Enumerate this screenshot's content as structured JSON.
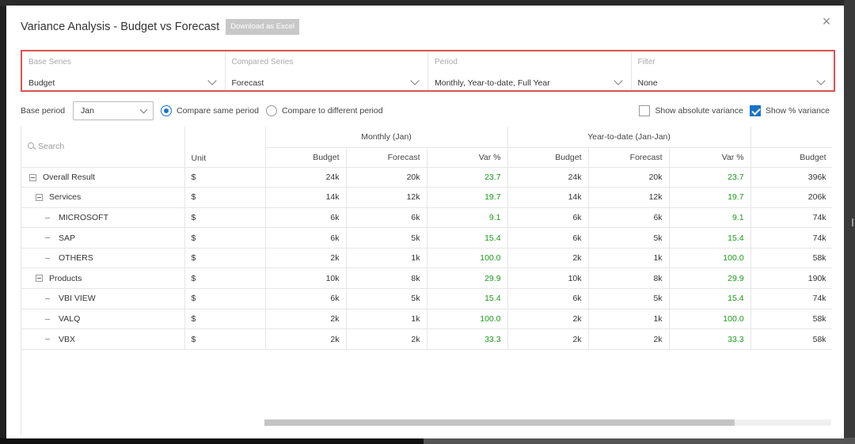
{
  "dialog": {
    "title": "Variance Analysis - Budget vs Forecast",
    "download_label": "Download as Excel",
    "close_glyph": "×"
  },
  "series": [
    {
      "label": "Base Series",
      "value": "Budget"
    },
    {
      "label": "Compared Series",
      "value": "Forecast"
    },
    {
      "label": "Period",
      "value": "Monthly, Year-to-date, Full Year"
    },
    {
      "label": "Filter",
      "value": "None"
    }
  ],
  "options": {
    "base_period_label": "Base period",
    "base_period_value": "Jan",
    "compare_same": "Compare same period",
    "compare_different": "Compare to different period",
    "compare_same_selected": true,
    "show_absolute": "Show absolute variance",
    "show_absolute_checked": false,
    "show_pct": "Show % variance",
    "show_pct_checked": true
  },
  "table": {
    "search_placeholder": "Search",
    "unit_header": "Unit",
    "groups": [
      "Monthly (Jan)",
      "Year-to-date (Jan-Jan)"
    ],
    "sub_headers": [
      "Budget",
      "Forecast",
      "Var %",
      "Budget",
      "Forecast",
      "Var %",
      "Budget"
    ],
    "rows": [
      {
        "name": "Overall Result",
        "level": 0,
        "type": "group",
        "unit": "$",
        "m_budget": "24k",
        "m_forecast": "20k",
        "m_var": "23.7",
        "y_budget": "24k",
        "y_forecast": "20k",
        "y_var": "23.7",
        "fy_budget": "396k"
      },
      {
        "name": "Services",
        "level": 1,
        "type": "group",
        "unit": "$",
        "m_budget": "14k",
        "m_forecast": "12k",
        "m_var": "19.7",
        "y_budget": "14k",
        "y_forecast": "12k",
        "y_var": "19.7",
        "fy_budget": "206k"
      },
      {
        "name": "MICROSOFT",
        "level": 2,
        "type": "leaf",
        "unit": "$",
        "m_budget": "6k",
        "m_forecast": "6k",
        "m_var": "9.1",
        "y_budget": "6k",
        "y_forecast": "6k",
        "y_var": "9.1",
        "fy_budget": "74k"
      },
      {
        "name": "SAP",
        "level": 2,
        "type": "leaf",
        "unit": "$",
        "m_budget": "6k",
        "m_forecast": "5k",
        "m_var": "15.4",
        "y_budget": "6k",
        "y_forecast": "5k",
        "y_var": "15.4",
        "fy_budget": "74k"
      },
      {
        "name": "OTHERS",
        "level": 2,
        "type": "leaf",
        "unit": "$",
        "m_budget": "2k",
        "m_forecast": "1k",
        "m_var": "100.0",
        "y_budget": "2k",
        "y_forecast": "1k",
        "y_var": "100.0",
        "fy_budget": "58k"
      },
      {
        "name": "Products",
        "level": 1,
        "type": "group",
        "unit": "$",
        "m_budget": "10k",
        "m_forecast": "8k",
        "m_var": "29.9",
        "y_budget": "10k",
        "y_forecast": "8k",
        "y_var": "29.9",
        "fy_budget": "190k"
      },
      {
        "name": "VBI VIEW",
        "level": 2,
        "type": "leaf",
        "unit": "$",
        "m_budget": "6k",
        "m_forecast": "5k",
        "m_var": "15.4",
        "y_budget": "6k",
        "y_forecast": "5k",
        "y_var": "15.4",
        "fy_budget": "74k"
      },
      {
        "name": "VALQ",
        "level": 2,
        "type": "leaf",
        "unit": "$",
        "m_budget": "2k",
        "m_forecast": "1k",
        "m_var": "100.0",
        "y_budget": "2k",
        "y_forecast": "1k",
        "y_var": "100.0",
        "fy_budget": "58k"
      },
      {
        "name": "VBX",
        "level": 2,
        "type": "leaf",
        "unit": "$",
        "m_budget": "2k",
        "m_forecast": "2k",
        "m_var": "33.3",
        "y_budget": "2k",
        "y_forecast": "2k",
        "y_var": "33.3",
        "fy_budget": "58k"
      }
    ]
  },
  "colors": {
    "accent": "#1a73c9",
    "positive_variance": "#1a9a1a",
    "highlight_border": "#d9534f"
  }
}
